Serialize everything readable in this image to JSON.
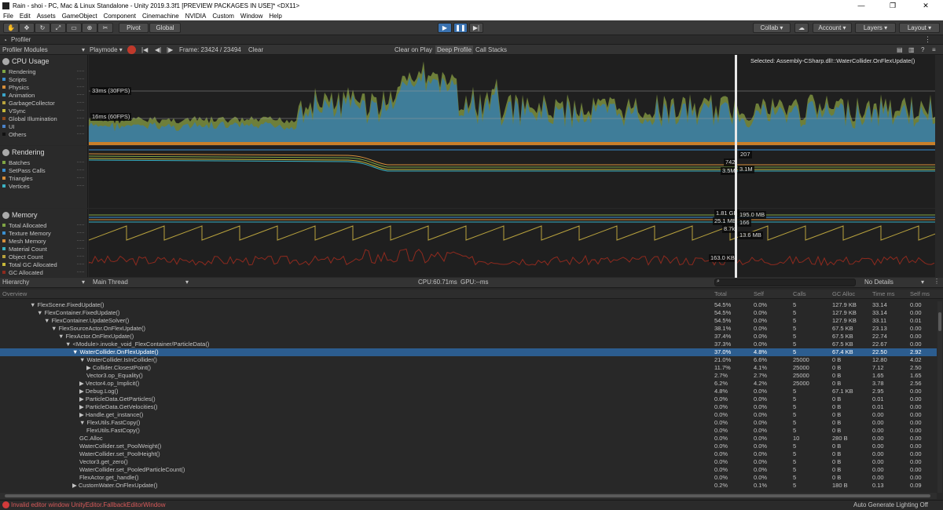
{
  "window": {
    "title": "Rain - shoi - PC, Mac & Linux Standalone - Unity 2019.3.3f1 [PREVIEW PACKAGES IN USE]* <DX11>"
  },
  "menu": [
    "File",
    "Edit",
    "Assets",
    "GameObject",
    "Component",
    "Cinemachine",
    "NVIDIA",
    "Custom",
    "Window",
    "Help"
  ],
  "toolbar": {
    "pivot": "Pivot",
    "global": "Global",
    "collab": "Collab ▾",
    "account": "Account",
    "layers": "Layers",
    "layout": "Layout"
  },
  "tab": {
    "label": "Profiler"
  },
  "profiler_toolbar": {
    "modules": "Profiler Modules",
    "mode": "Playmode",
    "frame": "Frame: 23424 / 23494",
    "clear": "Clear",
    "clear_on_play": "Clear on Play",
    "deep_profile": "Deep Profile",
    "call_stacks": "Call Stacks"
  },
  "cpu": {
    "title": "CPU Usage",
    "legend": [
      {
        "label": "Rendering",
        "color": "#7fa544"
      },
      {
        "label": "Scripts",
        "color": "#3a8fd1"
      },
      {
        "label": "Physics",
        "color": "#d88f3a"
      },
      {
        "label": "Animation",
        "color": "#3aa5c9"
      },
      {
        "label": "GarbageCollector",
        "color": "#b8a23d"
      },
      {
        "label": "VSync",
        "color": "#c7b93a"
      },
      {
        "label": "Global Illumination",
        "color": "#8f4a1e"
      },
      {
        "label": "UI",
        "color": "#4a82c9"
      },
      {
        "label": "Others",
        "color": "#111111"
      }
    ],
    "line30": "33ms (30FPS)",
    "line60": "16ms (60FPS)",
    "selected": "Selected: Assembly-CSharp.dll!::WaterCollider.OnFlexUpdate()"
  },
  "rendering": {
    "title": "Rendering",
    "legend": [
      {
        "label": "Batches",
        "color": "#7fa544"
      },
      {
        "label": "SetPass Calls",
        "color": "#3a8fd1"
      },
      {
        "label": "Triangles",
        "color": "#d88f3a"
      },
      {
        "label": "Vertices",
        "color": "#3ab2c4"
      }
    ],
    "labels": [
      "207",
      "742",
      "3.5M",
      "3.1M"
    ]
  },
  "memory": {
    "title": "Memory",
    "legend": [
      {
        "label": "Total Allocated",
        "color": "#7fa544"
      },
      {
        "label": "Texture Memory",
        "color": "#3a8fd1"
      },
      {
        "label": "Mesh Memory",
        "color": "#d88f3a"
      },
      {
        "label": "Material Count",
        "color": "#3ab2c4"
      },
      {
        "label": "Object Count",
        "color": "#b8a23d"
      },
      {
        "label": "Total GC Allocated",
        "color": "#c7b93a"
      },
      {
        "label": "GC Allocated",
        "color": "#8f2a1e"
      }
    ],
    "labels": [
      "1.81 GB",
      "195.0 MB",
      "25.1 MB",
      "166",
      "8.7k",
      "13.6 MB",
      "163.0 KB"
    ]
  },
  "details_bar": {
    "view": "Hierarchy",
    "thread": "Main Thread",
    "cpu": "CPU:60.71ms",
    "gpu": "GPU:--ms",
    "search_placeholder": "",
    "details": "No Details"
  },
  "columns": [
    "Overview",
    "Total",
    "Self",
    "Calls",
    "GC Alloc",
    "Time ms",
    "Self ms"
  ],
  "rows": [
    {
      "name": "▼ FlexScene.FixedUpdate()",
      "indent": 0,
      "total": "54.5%",
      "self": "0.0%",
      "calls": "5",
      "gc": "127.9 KB",
      "time": "33.14",
      "selfms": "0.00"
    },
    {
      "name": "▼ FlexContainer.FixedUpdate()",
      "indent": 1,
      "total": "54.5%",
      "self": "0.0%",
      "calls": "5",
      "gc": "127.9 KB",
      "time": "33.14",
      "selfms": "0.00"
    },
    {
      "name": "▼ FlexContainer.UpdateSolver()",
      "indent": 2,
      "total": "54.5%",
      "self": "0.0%",
      "calls": "5",
      "gc": "127.9 KB",
      "time": "33.11",
      "selfms": "0.01"
    },
    {
      "name": "▼ FlexSourceActor.OnFlexUpdate()",
      "indent": 3,
      "total": "38.1%",
      "self": "0.0%",
      "calls": "5",
      "gc": "67.5 KB",
      "time": "23.13",
      "selfms": "0.00"
    },
    {
      "name": "▼ FlexActor.OnFlexUpdate()",
      "indent": 4,
      "total": "37.4%",
      "self": "0.0%",
      "calls": "5",
      "gc": "67.5 KB",
      "time": "22.74",
      "selfms": "0.00"
    },
    {
      "name": "▼ <Module>.invoke_void_FlexContainer/ParticleData()",
      "indent": 5,
      "total": "37.3%",
      "self": "0.0%",
      "calls": "5",
      "gc": "67.5 KB",
      "time": "22.67",
      "selfms": "0.00"
    },
    {
      "name": "▼ WaterCollider.OnFlexUpdate()",
      "indent": 6,
      "total": "37.0%",
      "self": "4.8%",
      "calls": "5",
      "gc": "67.4 KB",
      "time": "22.50",
      "selfms": "2.92",
      "selected": true
    },
    {
      "name": "▼ WaterCollider.IsInCollider()",
      "indent": 7,
      "total": "21.0%",
      "self": "6.6%",
      "calls": "25000",
      "gc": "0 B",
      "time": "12.80",
      "selfms": "4.02"
    },
    {
      "name": "▶ Collider.ClosestPoint()",
      "indent": 8,
      "total": "11.7%",
      "self": "4.1%",
      "calls": "25000",
      "gc": "0 B",
      "time": "7.12",
      "selfms": "2.50"
    },
    {
      "name": "Vector3.op_Equality()",
      "indent": 8,
      "total": "2.7%",
      "self": "2.7%",
      "calls": "25000",
      "gc": "0 B",
      "time": "1.65",
      "selfms": "1.65"
    },
    {
      "name": "▶ Vector4.op_Implicit()",
      "indent": 7,
      "total": "6.2%",
      "self": "4.2%",
      "calls": "25000",
      "gc": "0 B",
      "time": "3.78",
      "selfms": "2.56"
    },
    {
      "name": "▶ Debug.Log()",
      "indent": 7,
      "total": "4.8%",
      "self": "0.0%",
      "calls": "5",
      "gc": "67.1 KB",
      "time": "2.95",
      "selfms": "0.00"
    },
    {
      "name": "▶ ParticleData.GetParticles()",
      "indent": 7,
      "total": "0.0%",
      "self": "0.0%",
      "calls": "5",
      "gc": "0 B",
      "time": "0.01",
      "selfms": "0.00"
    },
    {
      "name": "▶ ParticleData.GetVelocities()",
      "indent": 7,
      "total": "0.0%",
      "self": "0.0%",
      "calls": "5",
      "gc": "0 B",
      "time": "0.01",
      "selfms": "0.00"
    },
    {
      "name": "▶ Handle.get_instance()",
      "indent": 7,
      "total": "0.0%",
      "self": "0.0%",
      "calls": "5",
      "gc": "0 B",
      "time": "0.00",
      "selfms": "0.00"
    },
    {
      "name": "▼ FlexUtils.FastCopy()",
      "indent": 7,
      "total": "0.0%",
      "self": "0.0%",
      "calls": "5",
      "gc": "0 B",
      "time": "0.00",
      "selfms": "0.00"
    },
    {
      "name": "FlexUtils.FastCopy()",
      "indent": 8,
      "total": "0.0%",
      "self": "0.0%",
      "calls": "5",
      "gc": "0 B",
      "time": "0.00",
      "selfms": "0.00"
    },
    {
      "name": "GC.Alloc",
      "indent": 7,
      "total": "0.0%",
      "self": "0.0%",
      "calls": "10",
      "gc": "280 B",
      "time": "0.00",
      "selfms": "0.00"
    },
    {
      "name": "WaterCollider.set_PoolWeight()",
      "indent": 7,
      "total": "0.0%",
      "self": "0.0%",
      "calls": "5",
      "gc": "0 B",
      "time": "0.00",
      "selfms": "0.00"
    },
    {
      "name": "WaterCollider.set_PoolHeight()",
      "indent": 7,
      "total": "0.0%",
      "self": "0.0%",
      "calls": "5",
      "gc": "0 B",
      "time": "0.00",
      "selfms": "0.00"
    },
    {
      "name": "Vector3.get_zero()",
      "indent": 7,
      "total": "0.0%",
      "self": "0.0%",
      "calls": "5",
      "gc": "0 B",
      "time": "0.00",
      "selfms": "0.00"
    },
    {
      "name": "WaterCollider.set_PooledParticleCount()",
      "indent": 7,
      "total": "0.0%",
      "self": "0.0%",
      "calls": "5",
      "gc": "0 B",
      "time": "0.00",
      "selfms": "0.00"
    },
    {
      "name": "FlexActor.get_handle()",
      "indent": 7,
      "total": "0.0%",
      "self": "0.0%",
      "calls": "5",
      "gc": "0 B",
      "time": "0.00",
      "selfms": "0.00"
    },
    {
      "name": "▶ CustomWater.OnFlexUpdate()",
      "indent": 6,
      "total": "0.2%",
      "self": "0.1%",
      "calls": "5",
      "gc": "180 B",
      "time": "0.13",
      "selfms": "0.09"
    }
  ],
  "status": {
    "error": "Invalid editor window UnityEditor.FallbackEditorWindow",
    "right": "Auto Generate Lighting Off"
  }
}
